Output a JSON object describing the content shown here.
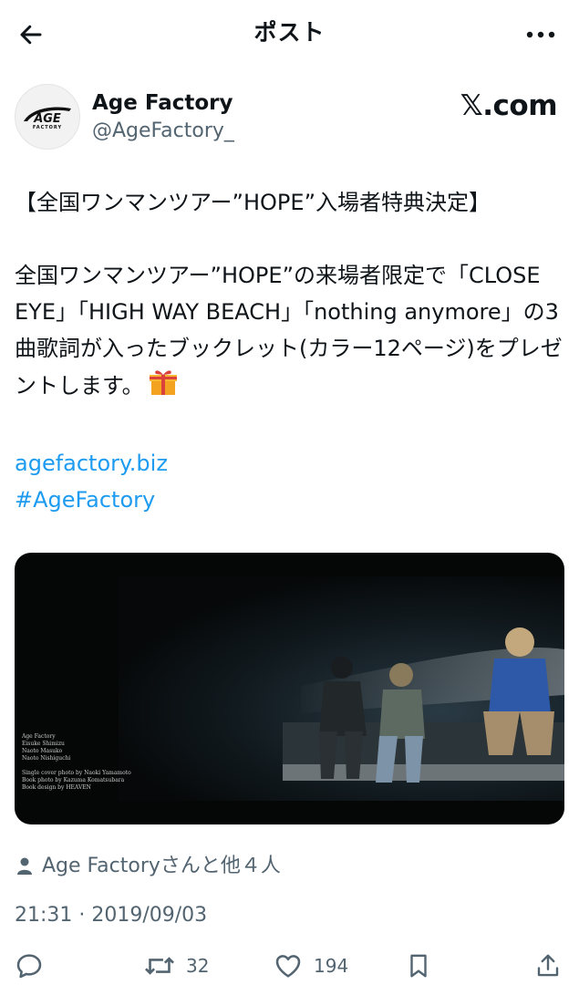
{
  "header": {
    "title": "ポスト"
  },
  "author": {
    "name": "Age Factory",
    "handle": "@AgeFactory_",
    "avatar_logo_text": "AGE FACTORY",
    "site": "𝕏.com"
  },
  "tweet": {
    "headline": "【全国ワンマンツアー”HOPE”入場者特典決定】",
    "body": "全国ワンマンツアー”HOPE”の来場者限定で「CLOSE EYE」「HIGH WAY BEACH」「nothing anymore」の3曲歌詞が入ったブックレット(カラー12ページ)をプレゼントします。",
    "link": "agefactory.biz",
    "hashtag": "#AgeFactory"
  },
  "media": {
    "credits": [
      "Age Factory",
      "Eisuke Shimizu",
      "Naoto Masuko",
      "Naoto Nishiguchi",
      "",
      "Single cover photo by Naoki Yamamoto",
      "Book photo by Kazuma Komatsubara",
      "Book design by HEAVEN"
    ]
  },
  "liked_by": "Age Factoryさんと他４人",
  "timestamp": "21:31 · 2019/09/03",
  "actions": {
    "retweets": "32",
    "likes": "194"
  },
  "colors": {
    "link": "#1d9bf0",
    "secondary": "#536471",
    "text": "#0f1419",
    "gift": "#f4a321"
  }
}
